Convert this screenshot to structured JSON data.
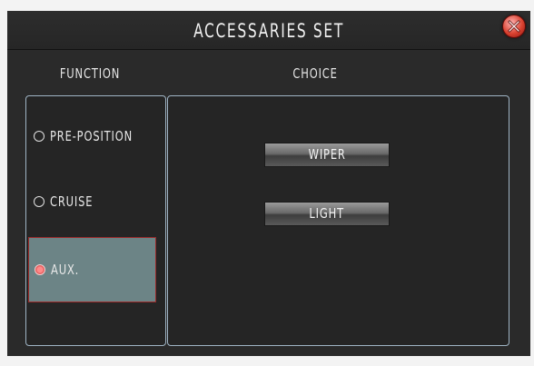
{
  "window": {
    "title": "ACCESSARIES SET",
    "close_icon": "close-icon",
    "accent_color": "#d9412f"
  },
  "columns": {
    "function_header": "FUNCTION",
    "choice_header": "CHOICE"
  },
  "functions": {
    "items": [
      {
        "label": "PRE-POSITION",
        "selected": false
      },
      {
        "label": "CRUISE",
        "selected": false
      },
      {
        "label": "AUX.",
        "selected": true
      }
    ],
    "selected_color": "#6c8486"
  },
  "choices": {
    "buttons": [
      {
        "label": "WIPER"
      },
      {
        "label": "LIGHT"
      }
    ]
  }
}
